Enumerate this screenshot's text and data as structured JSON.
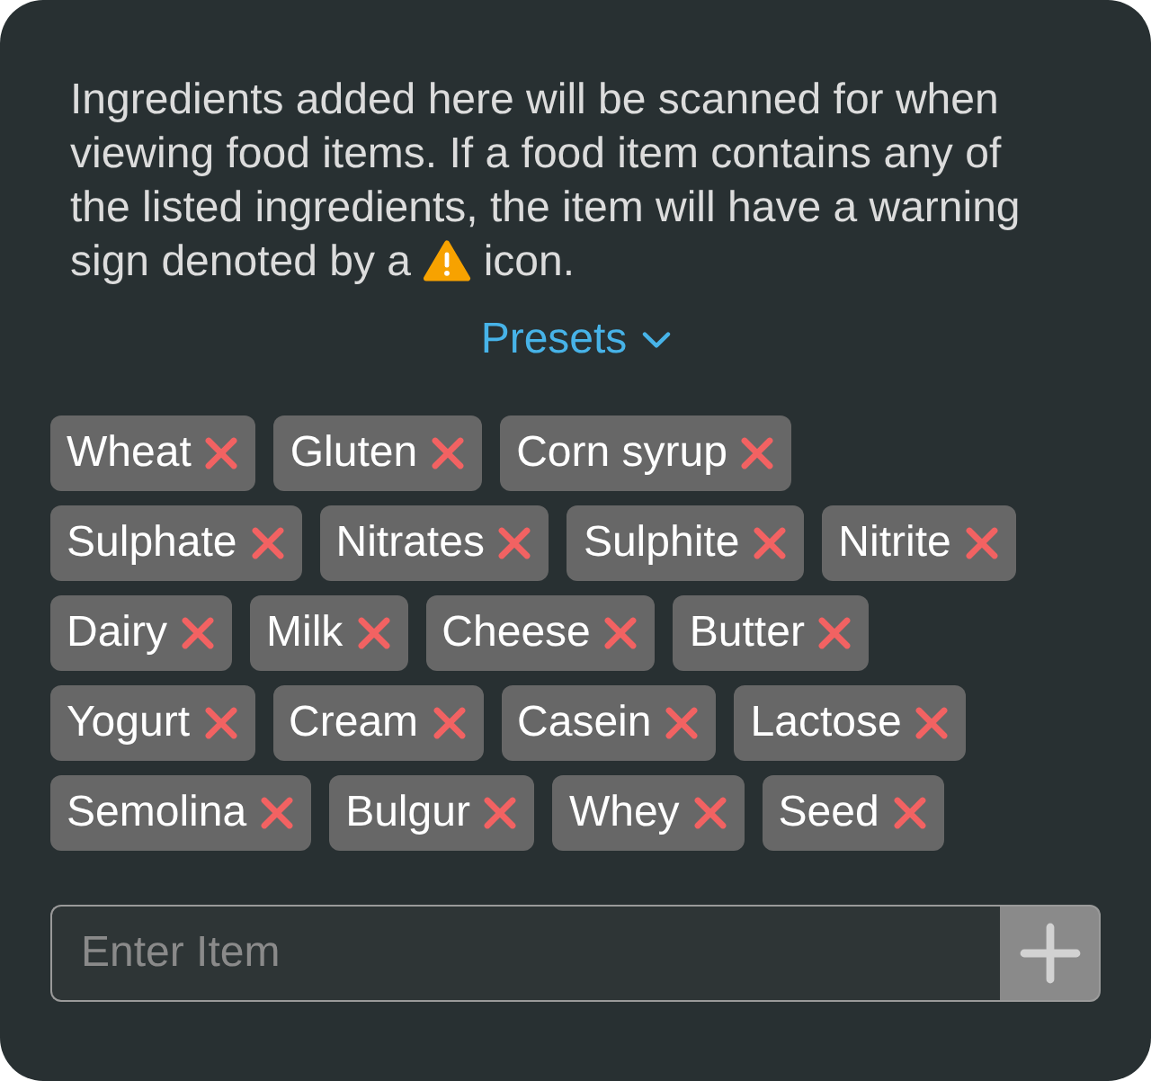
{
  "description": {
    "before_icon": "Ingredients added here will be scanned for when viewing food items. If a food item contains any of the listed ingredients, the item will have a warning sign denoted by a",
    "after_icon": "icon."
  },
  "presets": {
    "label": "Presets"
  },
  "ingredients": [
    "Wheat",
    "Gluten",
    "Corn syrup",
    "Sulphate",
    "Nitrates",
    "Sulphite",
    "Nitrite",
    "Dairy",
    "Milk",
    "Cheese",
    "Butter",
    "Yogurt",
    "Cream",
    "Casein",
    "Lactose",
    "Semolina",
    "Bulgur",
    "Whey",
    "Seed"
  ],
  "entry": {
    "placeholder": "Enter Item"
  }
}
